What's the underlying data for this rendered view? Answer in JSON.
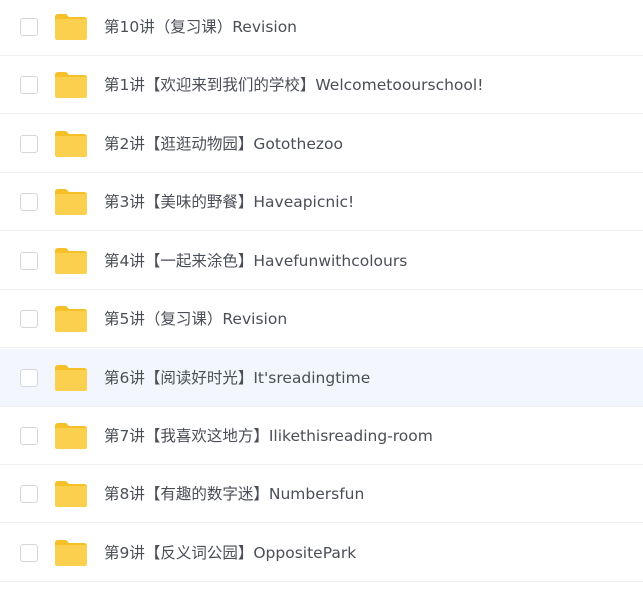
{
  "colors": {
    "folder": "#fcd04f",
    "folder_back": "#f5c028",
    "hover_row": "#f3f7fd",
    "text": "#4a4e57",
    "divider": "#f0f1f4",
    "checkbox_border": "#d3d6dc"
  },
  "file_list": {
    "items": [
      {
        "name": "第10讲（复习课）Revision",
        "icon": "folder-icon",
        "checked": false
      },
      {
        "name": "第1讲【欢迎来到我们的学校】Welcometoourschool!",
        "icon": "folder-icon",
        "checked": false
      },
      {
        "name": "第2讲【逛逛动物园】Gotothezoo",
        "icon": "folder-icon",
        "checked": false
      },
      {
        "name": "第3讲【美味的野餐】Haveapicnic!",
        "icon": "folder-icon",
        "checked": false
      },
      {
        "name": "第4讲【一起来涂色】Havefunwithcolours",
        "icon": "folder-icon",
        "checked": false
      },
      {
        "name": "第5讲（复习课）Revision",
        "icon": "folder-icon",
        "checked": false
      },
      {
        "name": "第6讲【阅读好时光】It'sreadingtime",
        "icon": "folder-icon",
        "checked": false,
        "hovered": true
      },
      {
        "name": "第7讲【我喜欢这地方】Ilikethisreading-room",
        "icon": "folder-icon",
        "checked": false
      },
      {
        "name": "第8讲【有趣的数字迷】Numbersfun",
        "icon": "folder-icon",
        "checked": false
      },
      {
        "name": "第9讲【反义词公园】OppositePark",
        "icon": "folder-icon",
        "checked": false
      }
    ]
  }
}
